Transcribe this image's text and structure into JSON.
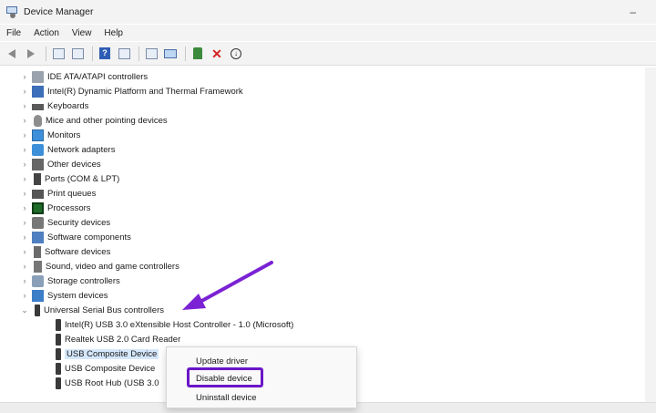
{
  "window": {
    "title": "Device Manager",
    "minimize_glyph": "–"
  },
  "menu": [
    "File",
    "Action",
    "View",
    "Help"
  ],
  "toolbar": [
    "back-icon",
    "forward-icon",
    "properties-icon",
    "list-icon",
    "help-icon",
    "view-icon",
    "scan-icon",
    "monitor-icon",
    "update-driver-icon",
    "uninstall-icon",
    "disable-icon"
  ],
  "tree": {
    "categories": [
      "IDE ATA/ATAPI controllers",
      "Intel(R) Dynamic Platform and Thermal Framework",
      "Keyboards",
      "Mice and other pointing devices",
      "Monitors",
      "Network adapters",
      "Other devices",
      "Ports (COM & LPT)",
      "Print queues",
      "Processors",
      "Security devices",
      "Software components",
      "Software devices",
      "Sound, video and game controllers",
      "Storage controllers",
      "System devices",
      "Universal Serial Bus controllers"
    ],
    "usb_children": [
      "Intel(R) USB 3.0 eXtensible Host Controller - 1.0 (Microsoft)",
      "Realtek USB 2.0 Card Reader",
      "USB Composite Device",
      "USB Composite Device",
      "USB Root Hub (USB 3.0"
    ],
    "selected_child": "USB Composite Device"
  },
  "context_menu": {
    "items": [
      "Update driver",
      "Disable device",
      "Uninstall device"
    ],
    "highlighted": "Disable device",
    "highlight_color": "#6a16c8"
  },
  "annotation": {
    "arrow_color": "#7b22d4"
  }
}
